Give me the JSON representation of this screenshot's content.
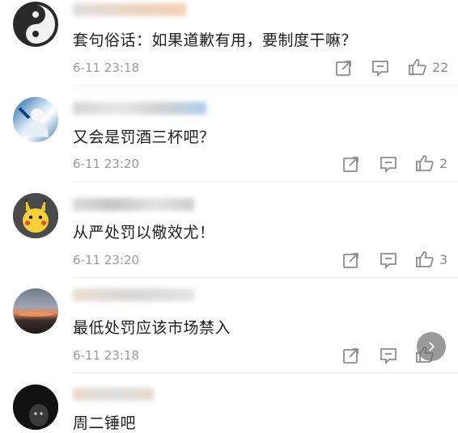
{
  "comments": [
    {
      "text": "套句俗话：如果道歉有用，要制度干嘛？",
      "time": "6-11 23:18",
      "likes": "22"
    },
    {
      "text": "又会是罚酒三杯吧？",
      "time": "6-11 23:20",
      "likes": "2"
    },
    {
      "text": "从严处罚以儆效尤！",
      "time": "6-11 23:20",
      "likes": "3"
    },
    {
      "text": "最低处罚应该市场禁入",
      "time": "6-11 23:18",
      "likes": ""
    },
    {
      "text": "周二锤吧",
      "time": "",
      "likes": ""
    }
  ],
  "icons": {
    "share": "share-icon",
    "reply": "comment-icon",
    "like": "thumbs-up-icon",
    "next": "chevron-right-icon"
  }
}
